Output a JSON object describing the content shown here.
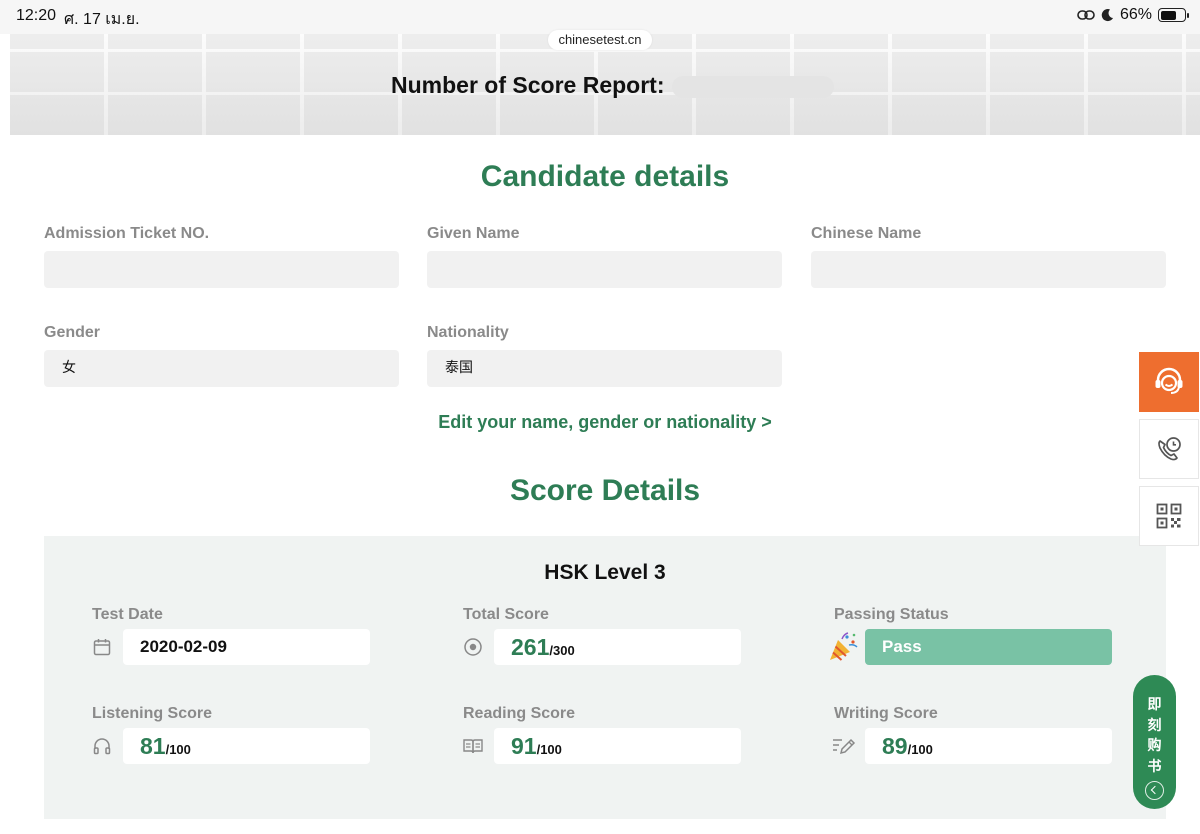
{
  "status_bar": {
    "time": "12:20",
    "date": "ศ. 17 เม.ย.",
    "battery": "66%",
    "battery_level": 0.66
  },
  "browser": {
    "url": "chinesetest.cn"
  },
  "header": {
    "report_number_label": "Number of Score Report:"
  },
  "candidate": {
    "title": "Candidate details",
    "admission_label": "Admission Ticket NO.",
    "admission_value": "",
    "given_name_label": "Given Name",
    "given_name_value": "",
    "chinese_name_label": "Chinese Name",
    "chinese_name_value": "",
    "gender_label": "Gender",
    "gender_value": "女",
    "nationality_label": "Nationality",
    "nationality_value": "泰国",
    "edit_link": "Edit your name, gender or nationality >"
  },
  "scores": {
    "title": "Score Details",
    "level": "HSK Level 3",
    "test_date_label": "Test Date",
    "test_date": "2020-02-09",
    "total_label": "Total Score",
    "total": "261",
    "total_max": "/300",
    "passing_label": "Passing Status",
    "passing_value": "Pass",
    "listening_label": "Listening Score",
    "listening": "81",
    "listening_max": "/100",
    "reading_label": "Reading Score",
    "reading": "91",
    "reading_max": "/100",
    "writing_label": "Writing Score",
    "writing": "89",
    "writing_max": "/100"
  },
  "floating": {
    "buttons": [
      "customer-service-icon",
      "phone-clock-icon",
      "qr-code-icon"
    ],
    "buy_now": "即刻购书"
  },
  "colors": {
    "accent_green": "#2e7d55",
    "pass_green": "#79c2a5",
    "service_orange": "#ee6e2f",
    "buy_green": "#2e8a55"
  }
}
